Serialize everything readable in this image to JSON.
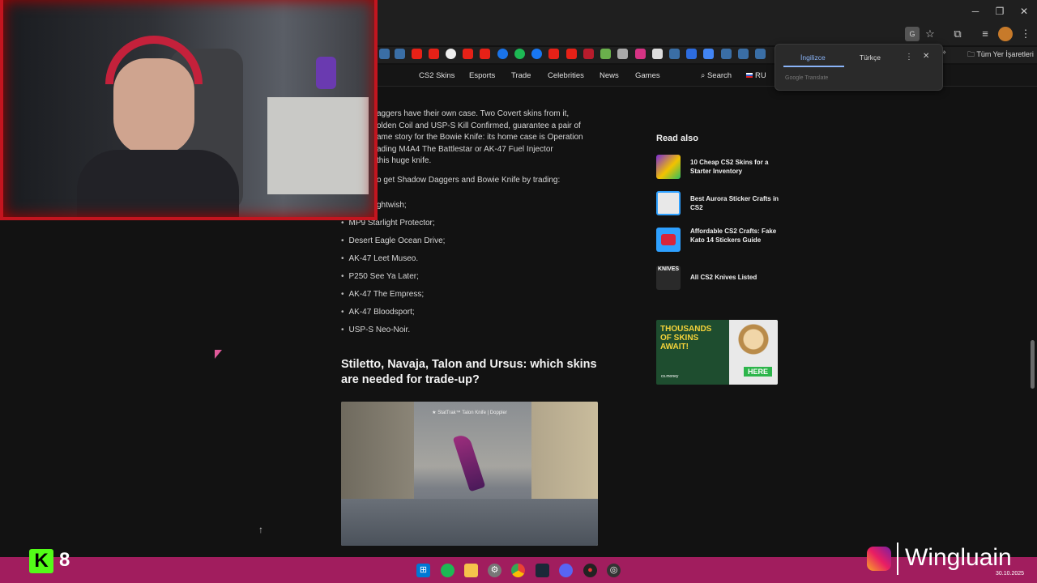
{
  "browser": {
    "bookmarks_folder": "Tüm Yer İşaretleri",
    "translate": {
      "lang_active": "İngilizce",
      "lang_other": "Türkçe",
      "brand": "Google Translate"
    }
  },
  "site_nav": {
    "links": [
      "CS2 Skins",
      "Esports",
      "Trade",
      "Celebrities",
      "News",
      "Games"
    ],
    "search_label": "Search",
    "lang_label": "RU"
  },
  "article": {
    "para1": [
      "aggers have their own case. Two Covert skins from it,",
      "olden Coil and USP-S Kill Confirmed, guarantee a pair of",
      "ame story for the Bowie Knife: its home case is Operation",
      "ading M4A4 The Battlestar or AK-47 Fuel Injector",
      " this huge knife."
    ],
    "para2": "o get Shadow Daggers and Bowie Knife by trading:",
    "list_first": "ghtwish;",
    "list": [
      "MP9 Starlight Protector;",
      "Desert Eagle Ocean Drive;",
      "AK-47 Leet Museo.",
      "P250 See Ya Later;",
      "AK-47 The Empress;",
      "AK-47 Bloodsport;",
      "USP-S Neo-Noir."
    ],
    "heading": "Stiletto, Navaja, Talon and Ursus: which skins are needed for trade-up?",
    "image_caption": "★ StatTrak™ Talon Knife | Doppler"
  },
  "sidebar": {
    "title": "Read also",
    "items": [
      {
        "label": "10 Cheap CS2 Skins for a Starter Inventory"
      },
      {
        "label": "Best Aurora Sticker Crafts in CS2"
      },
      {
        "label": "Affordable CS2 Crafts: Fake Kato 14 Stickers Guide"
      },
      {
        "label": "All CS2 Knives Listed"
      }
    ],
    "banner": {
      "line1": "THOUSANDS",
      "line2": "OF SKINS",
      "line3": "AWAIT!",
      "cta": "HERE",
      "brand": "cs.money"
    },
    "thumb_knives_text": "KNIVES"
  },
  "overlay": {
    "channel_badge": "8",
    "instagram_name": "Wingluain",
    "date": "30.10.2025"
  },
  "colors": {
    "taskbar": "#a11d5e",
    "accent_blue": "#8ab4f8",
    "page_bg": "#121212"
  }
}
